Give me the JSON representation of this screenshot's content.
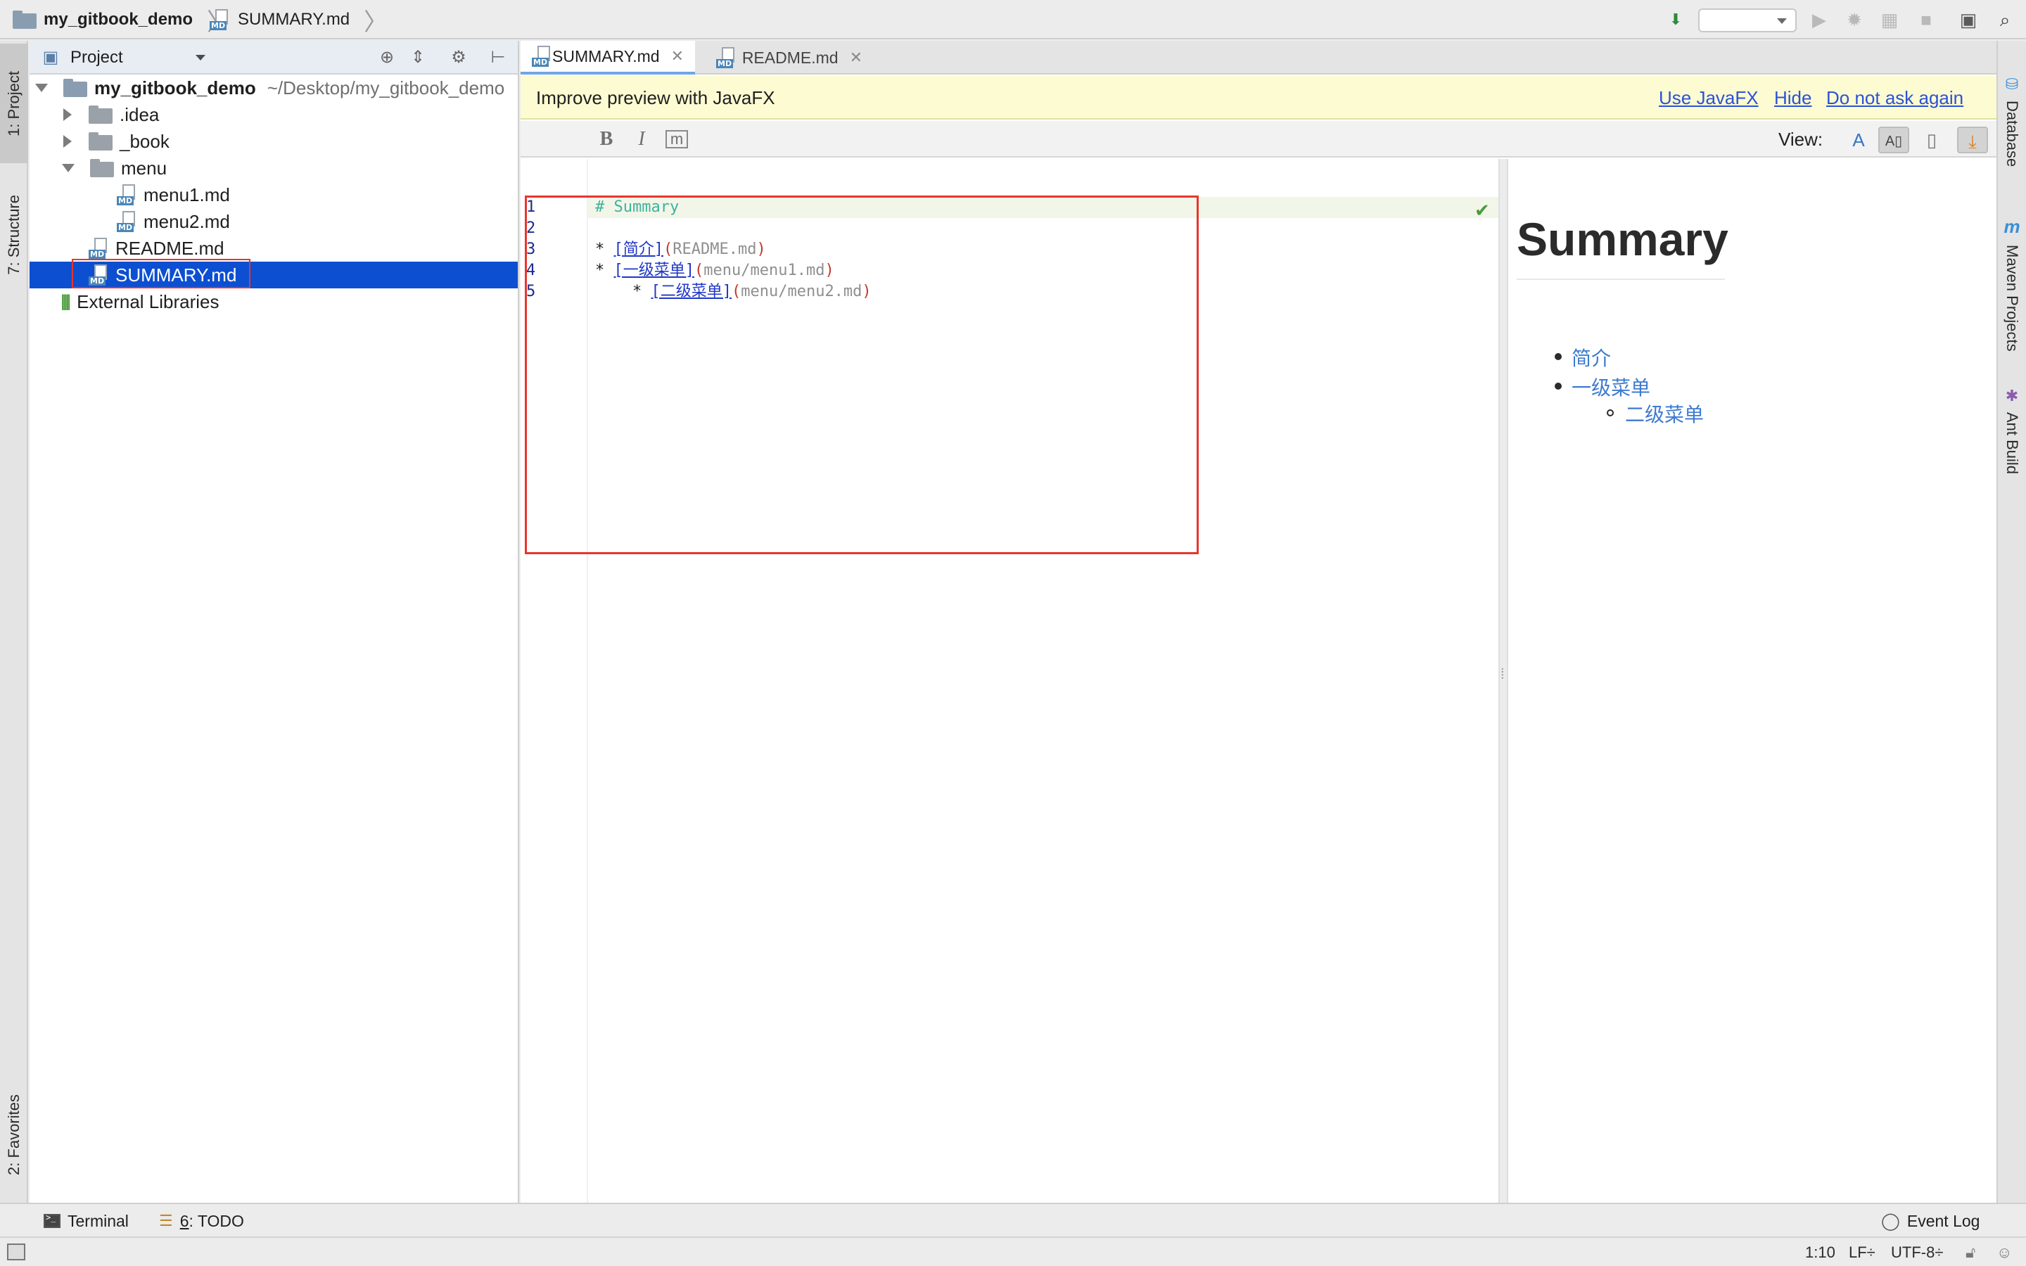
{
  "navbar": {
    "project_name": "my_gitbook_demo",
    "file_name": "SUMMARY.md"
  },
  "left_strip": {
    "project_tab": "1: Project",
    "structure_tab": "7: Structure",
    "favorites_tab": "2: Favorites"
  },
  "right_strip": {
    "database_tab": "Database",
    "maven_tab": "Maven Projects",
    "ant_tab": "Ant Build"
  },
  "project_panel": {
    "title": "Project",
    "root_name": "my_gitbook_demo",
    "root_path": "~/Desktop/my_gitbook_demo",
    "items": [
      {
        "label": ".idea",
        "type": "folder"
      },
      {
        "label": "_book",
        "type": "folder"
      },
      {
        "label": "menu",
        "type": "folder"
      },
      {
        "label": "menu1.md",
        "type": "md"
      },
      {
        "label": "menu2.md",
        "type": "md"
      },
      {
        "label": "README.md",
        "type": "md"
      },
      {
        "label": "SUMMARY.md",
        "type": "md",
        "selected": true
      },
      {
        "label": "External Libraries",
        "type": "lib"
      }
    ]
  },
  "editor": {
    "tabs": [
      {
        "label": "SUMMARY.md",
        "active": true
      },
      {
        "label": "README.md",
        "active": false
      }
    ],
    "notice": {
      "message": "Improve preview with JavaFX",
      "use_javafx": "Use JavaFX",
      "hide": "Hide",
      "do_not_ask": "Do not ask again"
    },
    "toolbar": {
      "bold": "B",
      "italic": "I",
      "code": "m",
      "view_label": "View:"
    },
    "source": {
      "line_numbers": [
        "1",
        "2",
        "3",
        "4",
        "5"
      ],
      "line1": "# Summary",
      "line3_text": "[简介]",
      "line3_url": "README.md",
      "line4_text": "[一级菜单]",
      "line4_url": "menu/menu1.md",
      "line5_text": "[二级菜单]",
      "line5_url": "menu/menu2.md"
    },
    "preview": {
      "heading": "Summary",
      "items": [
        "简介",
        "一级菜单",
        "二级菜单"
      ]
    }
  },
  "bottom_bar": {
    "terminal": "Terminal",
    "todo_number": "6",
    "todo_label": ": TODO",
    "event_log": "Event Log"
  },
  "status_bar": {
    "position": "1:10",
    "line_sep": "LF÷",
    "encoding": "UTF-8÷"
  },
  "colors": {
    "selection": "#0d4fd1",
    "highlight_box": "#e8352d",
    "link": "#3d7bd0",
    "notice_bg": "#fcfbd2"
  }
}
